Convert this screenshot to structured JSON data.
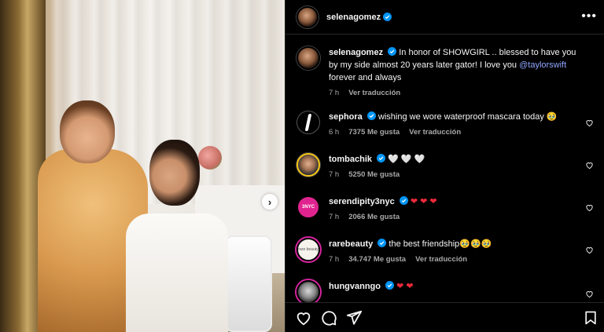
{
  "post": {
    "author": "selenagomez",
    "more_label": "•••",
    "next_label": "›"
  },
  "caption": {
    "username": "selenagomez",
    "text_before": "In honor of SHOWGIRL .. blessed to have you by my side almost 20 years later gator! I love you ",
    "mention": "@taylorswift",
    "text_after": " forever and always",
    "time": "7 h",
    "translate": "Ver traducción"
  },
  "comments": [
    {
      "username": "sephora",
      "text": "wishing we wore waterproof mascara today 🥹",
      "time": "6 h",
      "likes": "7375 Me gusta",
      "translate": "Ver traducción"
    },
    {
      "username": "tombachik",
      "text": "🤍 🤍 🤍",
      "time": "7 h",
      "likes": "5250 Me gusta",
      "translate": ""
    },
    {
      "username": "serendipity3nyc",
      "text": "❤ ❤ ❤",
      "time": "7 h",
      "likes": "2066 Me gusta",
      "translate": "",
      "avatar_text": "3NYC"
    },
    {
      "username": "rarebeauty",
      "text": "the best friendship🥹🥹🥹",
      "time": "7 h",
      "likes": "34.747 Me gusta",
      "translate": "Ver traducción",
      "avatar_text": "rare beauty"
    },
    {
      "username": "hungvanngo",
      "text": "❤ ❤",
      "time": "",
      "likes": "",
      "translate": ""
    }
  ],
  "icons": {
    "verified": "verified-badge-icon",
    "heart": "heart-outline-icon",
    "comment": "comment-icon",
    "share": "share-icon",
    "bookmark": "bookmark-icon"
  },
  "colors": {
    "background": "#000000",
    "text": "#f5f5f5",
    "muted": "#a8a8a8",
    "verified": "#0095f6",
    "mention": "#8fa6ff",
    "heart_red": "#ed2a3b"
  }
}
